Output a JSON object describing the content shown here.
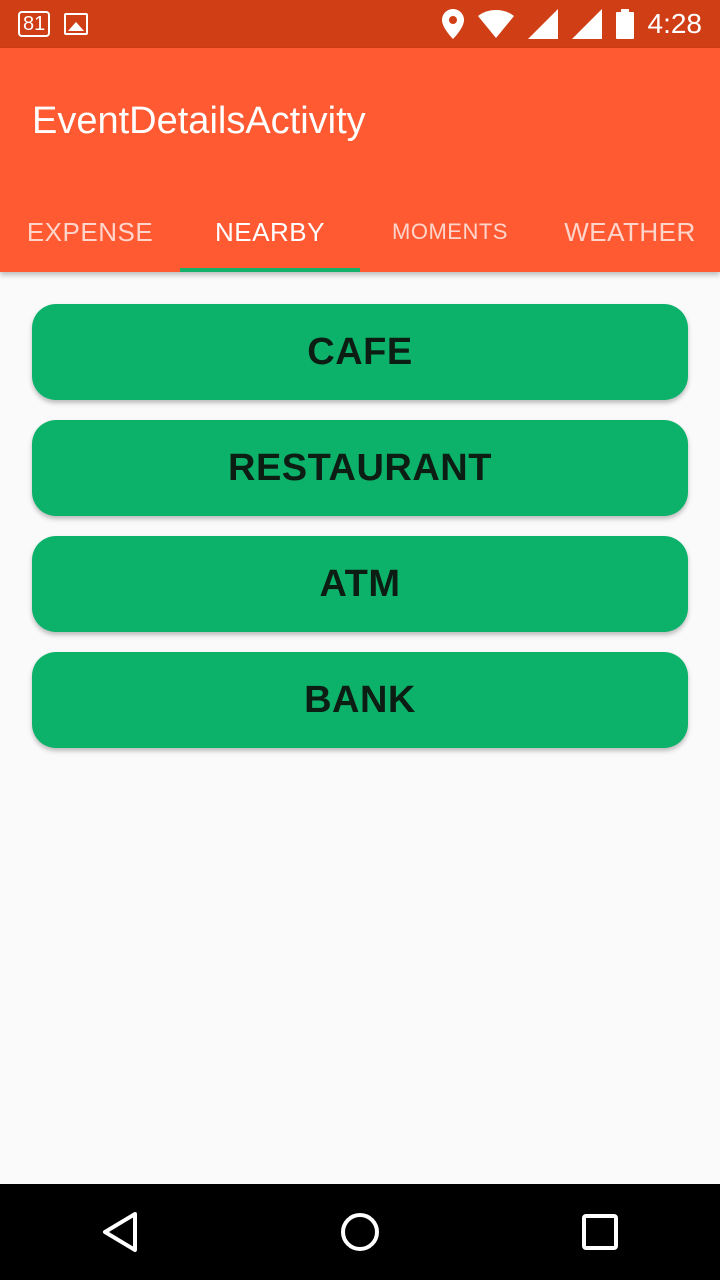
{
  "status_bar": {
    "notification_count": "81",
    "time": "4:28"
  },
  "app_bar": {
    "title": "EventDetailsActivity"
  },
  "tabs": [
    {
      "label": "EXPENSE",
      "active": false
    },
    {
      "label": "NEARBY",
      "active": true
    },
    {
      "label": "MOMENTS",
      "active": false
    },
    {
      "label": "WEATHER",
      "active": false
    }
  ],
  "nearby_buttons": [
    "CAFE",
    "RESTAURANT",
    "ATM",
    "BANK"
  ],
  "colors": {
    "status_bar": "#D03E15",
    "app_bar": "#FF5A32",
    "button": "#0CB269",
    "tab_indicator": "#14B06A"
  },
  "icons": [
    "notification-badge-icon",
    "image-icon",
    "location-icon",
    "wifi-icon",
    "signal-icon",
    "signal-icon-2",
    "battery-icon",
    "back-icon",
    "home-icon",
    "recents-icon"
  ]
}
